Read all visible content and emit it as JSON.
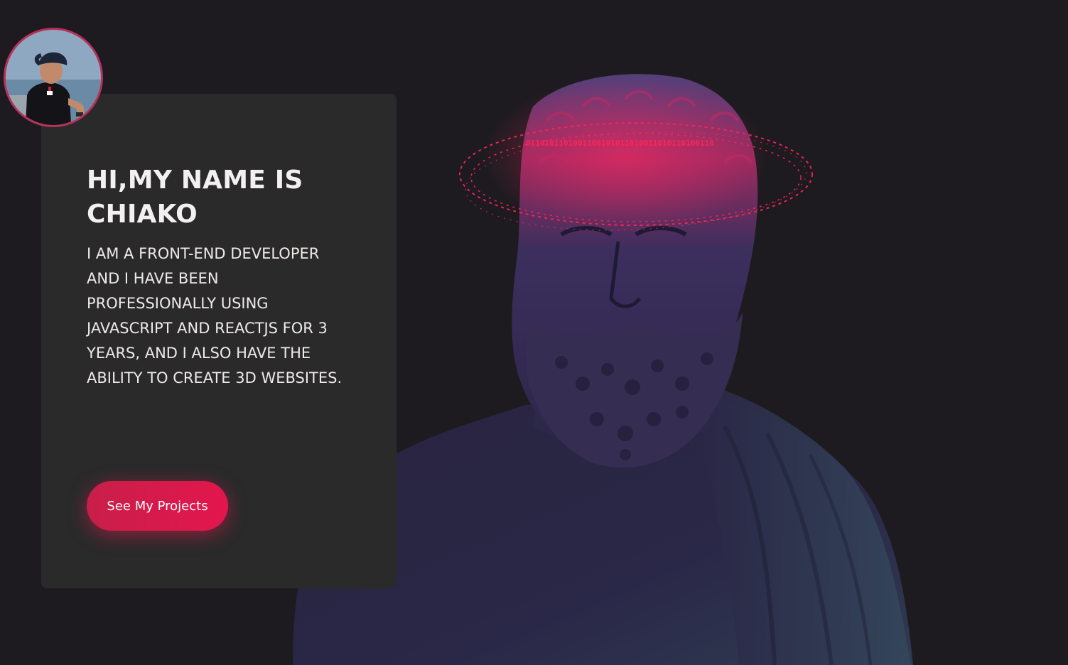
{
  "theme": {
    "background": "#1e1b20",
    "card_background": "#2a2a2b",
    "accent": "#dc1a4c",
    "halo_color": "#ff2456"
  },
  "profile": {
    "avatar_icon": "profile-photo"
  },
  "intro": {
    "title": "HI,MY NAME IS CHIAKO",
    "description": "I AM A FRONT-END DEVELOPER AND I HAVE BEEN PROFESSIONALLY USING JAVASCRIPT AND REACTJS FOR 3 YEARS, AND I ALSO HAVE THE ABILITY TO CREATE 3D WEBSITES.",
    "cta_label": "See My Projects"
  },
  "scene": {
    "model": "greek-philosopher-bust",
    "halo_text": "0110101101001100101011010011010110100110"
  }
}
